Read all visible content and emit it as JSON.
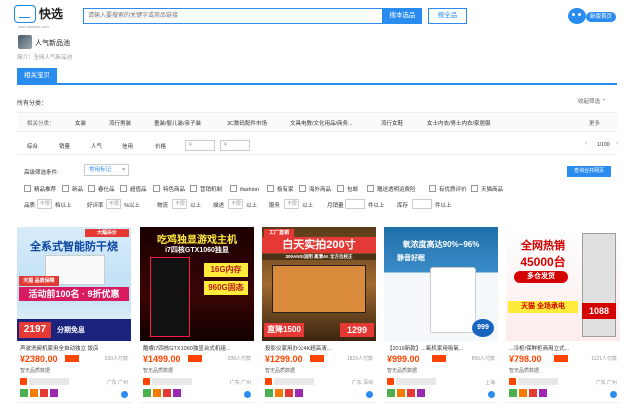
{
  "header": {
    "logo_text": "快选",
    "logo_sub": "xuan.taobao.com",
    "search_placeholder": "请输入要搜索的关键字或商品链接",
    "search_button": "搜本选品",
    "search_all_button": "搜全品",
    "new_home": "新版首页"
  },
  "pool": {
    "name": "人气新品池",
    "desc": "简介：全网人气新品池"
  },
  "tabs": {
    "active": "相关宝贝"
  },
  "categories": {
    "all_label": "所有分类：",
    "collapse": "收起筛选",
    "row_label": "相关分类：",
    "items": [
      "女装",
      "流行男装",
      "童装/婴儿装/亲子装",
      "3C数码配件市场",
      "文具电教/文化用品/商务...",
      "流行女鞋",
      "女士内衣/男士内衣/家居服"
    ],
    "more": "更多"
  },
  "sort": {
    "items": [
      "综合",
      "销量",
      "人气",
      "信用",
      "价格"
    ],
    "price_from": "¥",
    "price_to": "¥",
    "dash": "-",
    "pager_prev": "‹",
    "pager_text": "1/100",
    "pager_next": "›"
  },
  "advanced": {
    "label": "高级筛选条件:",
    "select": "常用标记",
    "merge_button": "查询合并网页"
  },
  "checkboxes": [
    "精品推荐",
    "新品",
    "春仕品",
    "超值品",
    "特色商品",
    "营销机制",
    "ifashion",
    "极有家",
    "海外商品",
    "包邮",
    "赠送透明运费险",
    "有优质评价",
    "天猫商品"
  ],
  "filters": [
    {
      "label": "品质",
      "box": "不限",
      "suffix": "档以上"
    },
    {
      "label": "好评率",
      "box": "不限",
      "suffix": "%以上"
    },
    {
      "label": "物流",
      "box": "不限",
      "suffix": "以上"
    },
    {
      "label": "描述",
      "box": "不限",
      "suffix": "以上"
    },
    {
      "label": "服务",
      "box": "不限",
      "suffix": "以上"
    },
    {
      "label": "月销量",
      "box": "",
      "suffix": "件以上"
    },
    {
      "label": "库存",
      "box": "",
      "suffix": "件以上"
    }
  ],
  "products": [
    {
      "banner_top": "大幅杀价",
      "banner_main": "全系式智能防干烧",
      "banner_sub": "天猫 品质保障",
      "banner_act": "活动前100名 · 9折优惠",
      "banner_price": "2197",
      "banner_tag": "分期免息",
      "title": "声波洗碗机家用全自动独立 饭店",
      "price": "¥2380.00",
      "paid": "330人付款",
      "shop": "智无品质数据",
      "loc": "广东 广州"
    },
    {
      "banner_top": "吃鸡独显游戏主机",
      "banner_main": "i7四核GTX1060独显",
      "banner_sub": "16G内存",
      "banner_act": "960G固态",
      "banner_price": "",
      "banner_tag": "",
      "title": "酷睿i7四核GTX1060独显台式机组...",
      "price": "¥1499.00",
      "paid": "298人付款",
      "shop": "智无品质数据",
      "loc": "广东 广州"
    },
    {
      "banner_top": "工厂直销",
      "banner_main": "白天实拍200寸",
      "banner_sub": "300ANSI流明 高清4K 全方位校正",
      "banner_act": "直降1500",
      "banner_price": "1299",
      "banner_tag": "",
      "title": "投影仪家用办公4K超高清...",
      "price": "¥1299.00",
      "paid": "1829人付款",
      "shop": "智无品质数据",
      "loc": "广东 深圳"
    },
    {
      "banner_top": "",
      "banner_main": "氧浓度高达90%~96%",
      "banner_sub": "静音好眠",
      "banner_act": "",
      "banner_price": "999",
      "banner_tag": "",
      "title": "【2019新款】...氧机家用吸氧...",
      "price": "¥999.00",
      "paid": "890人付款",
      "shop": "智无品质数据",
      "loc": "上海"
    },
    {
      "banner_top": "",
      "banner_main": "全网热销",
      "banner_sub": "45000台",
      "banner_act": "多仓发货",
      "banner_price": "1088",
      "banner_tag": "天猫 全场承电",
      "title": "...冷柜/保鲜柜商用立式...",
      "price": "¥798.00",
      "paid": "1121人付款",
      "shop": "智无品质数据",
      "loc": "广东 广州"
    }
  ],
  "colors": {
    "accent": "#2b8cf0",
    "price": "#ff4400"
  }
}
